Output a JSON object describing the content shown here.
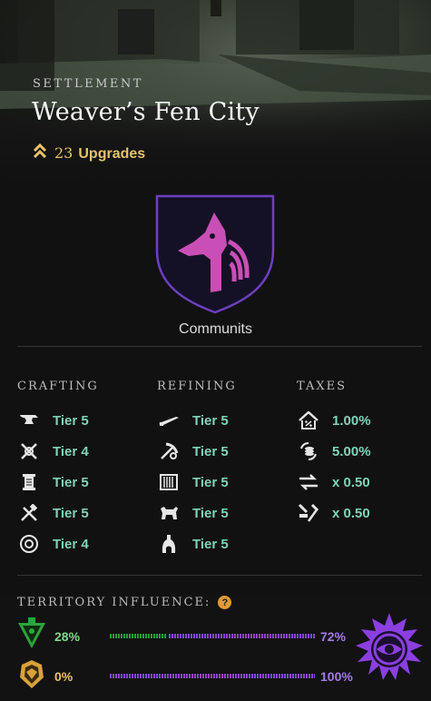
{
  "header": {
    "kicker": "SETTLEMENT",
    "title": "Weaver’s Fen City",
    "upgrades_count": "23",
    "upgrades_label": "Upgrades"
  },
  "company": {
    "name": "Communits",
    "accent": "#c94fb6",
    "shield_bg": "#141126",
    "shield_border": "#6e3fc2"
  },
  "columns": {
    "crafting": {
      "title": "CRAFTING",
      "items": [
        {
          "icon": "anvil-icon",
          "text": "Tier 5"
        },
        {
          "icon": "crossed-tools-icon",
          "text": "Tier 4"
        },
        {
          "icon": "scroll-icon",
          "text": "Tier 5"
        },
        {
          "icon": "hammer-saw-icon",
          "text": "Tier 5"
        },
        {
          "icon": "ring-gem-icon",
          "text": "Tier 4"
        }
      ]
    },
    "refining": {
      "title": "REFINING",
      "items": [
        {
          "icon": "sword-blade-icon",
          "text": "Tier 5"
        },
        {
          "icon": "pickaxe-gear-icon",
          "text": "Tier 5"
        },
        {
          "icon": "loom-icon",
          "text": "Tier 5"
        },
        {
          "icon": "tannery-icon",
          "text": "Tier 5"
        },
        {
          "icon": "smelter-icon",
          "text": "Tier 5"
        }
      ]
    },
    "taxes": {
      "title": "TAXES",
      "items": [
        {
          "icon": "house-tax-icon",
          "text": "1.00%"
        },
        {
          "icon": "coin-cycle-icon",
          "text": "5.00%"
        },
        {
          "icon": "trade-arrows-icon",
          "text": "x 0.50"
        },
        {
          "icon": "anvil-hammer-icon",
          "text": "x 0.50"
        }
      ]
    }
  },
  "territory": {
    "title": "TERRITORY INFLUENCE:",
    "help": "?",
    "rows": [
      {
        "faction": "green-faction",
        "left_pct": "28%",
        "left_value": 28,
        "right_pct": "72%",
        "right_value": 72,
        "left_color": "#2e9b3a",
        "right_color": "#8a45d6"
      },
      {
        "faction": "yellow-faction",
        "left_pct": "0%",
        "left_value": 0,
        "right_pct": "100%",
        "right_value": 100,
        "left_color": "#d8a23a",
        "right_color": "#8a45d6"
      }
    ]
  }
}
